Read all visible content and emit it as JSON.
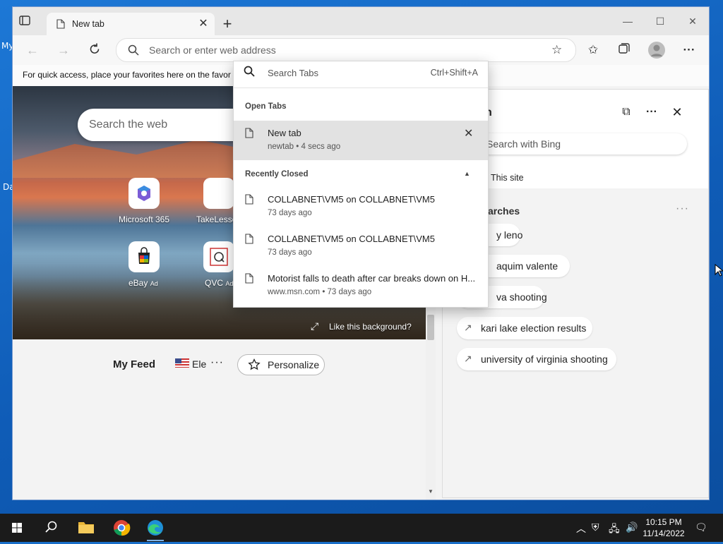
{
  "browser": {
    "tab": {
      "title": "New tab"
    },
    "address_placeholder": "Search or enter web address",
    "favorites_bar_text": "For quick access, place your favorites here on the favor"
  },
  "new_tab_page": {
    "search_placeholder": "Search the web",
    "quick_links": [
      {
        "label": "Microsoft 365",
        "icon": "microsoft-365-icon"
      },
      {
        "label": "TakeLesso",
        "icon": "takelessons-icon"
      },
      {
        "label": "eBay",
        "badge": "Ad",
        "icon": "ebay-icon"
      },
      {
        "label": "QVC",
        "badge": "Ad",
        "icon": "qvc-icon"
      }
    ],
    "background_prompt": "Like this background?",
    "feed": {
      "title": "My Feed",
      "region_label": "Ele",
      "more": "···",
      "personalize_label": "Personalize"
    }
  },
  "tab_search": {
    "placeholder": "Search Tabs",
    "shortcut": "Ctrl+Shift+A",
    "open_tabs_header": "Open Tabs",
    "open_tabs": [
      {
        "title": "New tab",
        "subtitle": "newtab • 4 secs ago"
      }
    ],
    "recently_closed_header": "Recently Closed",
    "recently_closed": [
      {
        "title": "COLLABNET\\VM5 on COLLABNET\\VM5",
        "subtitle": "73 days ago"
      },
      {
        "title": "COLLABNET\\VM5 on COLLABNET\\VM5",
        "subtitle": "73 days ago"
      },
      {
        "title": "Motorist falls to death after car breaks down on H...",
        "subtitle": "www.msn.com • 73 days ago"
      }
    ]
  },
  "sidebar": {
    "title_fragment": "n",
    "search_placeholder": "Search with Bing",
    "scope_label": "This site",
    "trending_header": "g searches",
    "more": "···",
    "trends": [
      {
        "text": "y leno",
        "trend_icon": false
      },
      {
        "text": "aquim valente",
        "trend_icon": false
      },
      {
        "text": "va shooting",
        "trend_icon": false
      },
      {
        "text": "kari lake election results",
        "trend_icon": true
      },
      {
        "text": "university of virginia shooting",
        "trend_icon": true
      }
    ]
  },
  "desktop": {
    "icon_fragments": [
      "My",
      "Da"
    ]
  },
  "taskbar": {
    "clock_time": "10:15 PM",
    "clock_date": "11/14/2022"
  },
  "colors": {
    "taskbar": "#1b1b1b",
    "desktop": "#1a6fc9",
    "active_row": "#e2e2e2"
  }
}
